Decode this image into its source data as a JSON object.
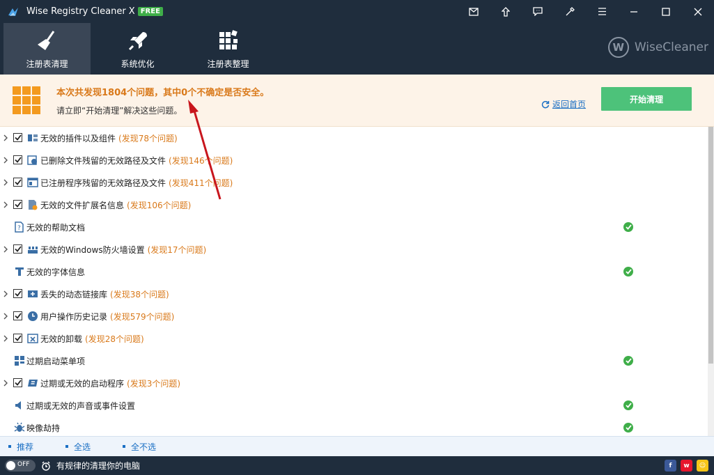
{
  "window": {
    "title": "Wise Registry Cleaner X",
    "badge": "FREE",
    "icons": [
      "mail-icon",
      "upgrade-icon",
      "feedback-icon",
      "skin-icon",
      "menu-icon",
      "minimize-icon",
      "maximize-icon",
      "close-icon"
    ]
  },
  "nav": {
    "tabs": [
      {
        "label": "注册表清理",
        "icon": "broom-icon",
        "active": true
      },
      {
        "label": "系统优化",
        "icon": "rocket-icon",
        "active": false
      },
      {
        "label": "注册表整理",
        "icon": "blocks-icon",
        "active": false
      }
    ],
    "brand": "WiseCleaner",
    "brand_mark": "W"
  },
  "banner": {
    "title": "本次共发现1804个问题，其中0个不确定是否安全。",
    "subtitle": "请立即“开始清理”解决这些问题。",
    "back_link": "返回首页",
    "start_button": "开始清理"
  },
  "items": [
    {
      "label": "无效的插件以及组件",
      "count": "(发现78个问题)",
      "checkable": true,
      "ok": false,
      "icon": "plugin-icon"
    },
    {
      "label": "已删除文件残留的无效路径及文件",
      "count": "(发现146个问题)",
      "checkable": true,
      "ok": false,
      "icon": "deleted-file-icon"
    },
    {
      "label": "已注册程序残留的无效路径及文件",
      "count": "(发现411个问题)",
      "checkable": true,
      "ok": false,
      "icon": "program-icon"
    },
    {
      "label": "无效的文件扩展名信息",
      "count": "(发现106个问题)",
      "checkable": true,
      "ok": false,
      "icon": "file-extension-icon"
    },
    {
      "label": "无效的帮助文档",
      "count": "",
      "checkable": false,
      "ok": true,
      "icon": "help-doc-icon"
    },
    {
      "label": "无效的Windows防火墙设置",
      "count": "(发现17个问题)",
      "checkable": true,
      "ok": false,
      "icon": "firewall-icon"
    },
    {
      "label": "无效的字体信息",
      "count": "",
      "checkable": false,
      "ok": true,
      "icon": "font-icon"
    },
    {
      "label": "丢失的动态链接库",
      "count": "(发现38个问题)",
      "checkable": true,
      "ok": false,
      "icon": "dll-icon"
    },
    {
      "label": "用户操作历史记录",
      "count": "(发现579个问题)",
      "checkable": true,
      "ok": false,
      "icon": "history-icon"
    },
    {
      "label": "无效的卸载",
      "count": "(发现28个问题)",
      "checkable": true,
      "ok": false,
      "icon": "uninstall-icon"
    },
    {
      "label": "过期启动菜单项",
      "count": "",
      "checkable": false,
      "ok": true,
      "icon": "start-menu-icon"
    },
    {
      "label": "过期或无效的启动程序",
      "count": "(发现3个问题)",
      "checkable": true,
      "ok": false,
      "icon": "startup-icon"
    },
    {
      "label": "过期或无效的声音或事件设置",
      "count": "",
      "checkable": false,
      "ok": true,
      "icon": "sound-icon"
    },
    {
      "label": "映像劫持",
      "count": "",
      "checkable": false,
      "ok": true,
      "icon": "hijack-icon"
    }
  ],
  "footer": {
    "links": [
      "推荐",
      "全选",
      "全不选"
    ]
  },
  "status": {
    "toggle": "OFF",
    "text": "有规律的清理你的电脑"
  },
  "colors": {
    "titlebar": "#1f2d3d",
    "accent_orange": "#d9791a",
    "start_green": "#4dc27a",
    "link_blue": "#1a6fc4",
    "ok_green": "#3fae49"
  }
}
